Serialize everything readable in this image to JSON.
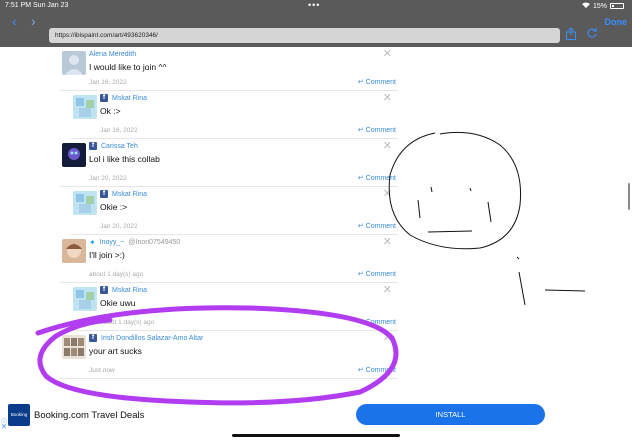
{
  "status": {
    "time": "7:51 PM  Sun Jan 23",
    "dots": "•••",
    "wifi": "wifi-icon",
    "battery_text": "15%"
  },
  "browser": {
    "url": "https://ibispaint.com/art/493620346/",
    "done_label": "Done"
  },
  "comments": [
    {
      "name": "Alena Meredith",
      "text": "I would like to join ^^",
      "date": "Jan 16, 2022",
      "reply": "Comment"
    },
    {
      "name": "Mskat Rina",
      "text": "Ok :>",
      "date": "Jan 16, 2022",
      "reply": "Comment"
    },
    {
      "name": "Carissa Teh",
      "text": "Lol i like this collab",
      "date": "Jan 20, 2022",
      "reply": "Comment"
    },
    {
      "name": "Mskat Rina",
      "text": "Okie :>",
      "date": "Jan 20, 2022",
      "reply": "Comment"
    },
    {
      "name": "Inoyy_~",
      "handle": "@Inori07549450",
      "text": "I'll join >:)",
      "date": "about 1 day(s) ago",
      "reply": "Comment"
    },
    {
      "name": "Mskat Rina",
      "text": "Okie uwu",
      "date": "about 1 day(s) ago",
      "reply": "Comment"
    },
    {
      "name": "Irish Dondillos Salazar-Amo Altar",
      "text": "your art sucks",
      "date": "Just now",
      "reply": "Comment"
    }
  ],
  "ad": {
    "title": "Booking.com Travel Deals",
    "logo_text": "Booking",
    "button": "INSTALL"
  },
  "colors": {
    "chrome": "#5a5a5a",
    "link": "#3a8ad6",
    "install": "#1a73e8",
    "annotation_purple": "#b23cf0"
  }
}
